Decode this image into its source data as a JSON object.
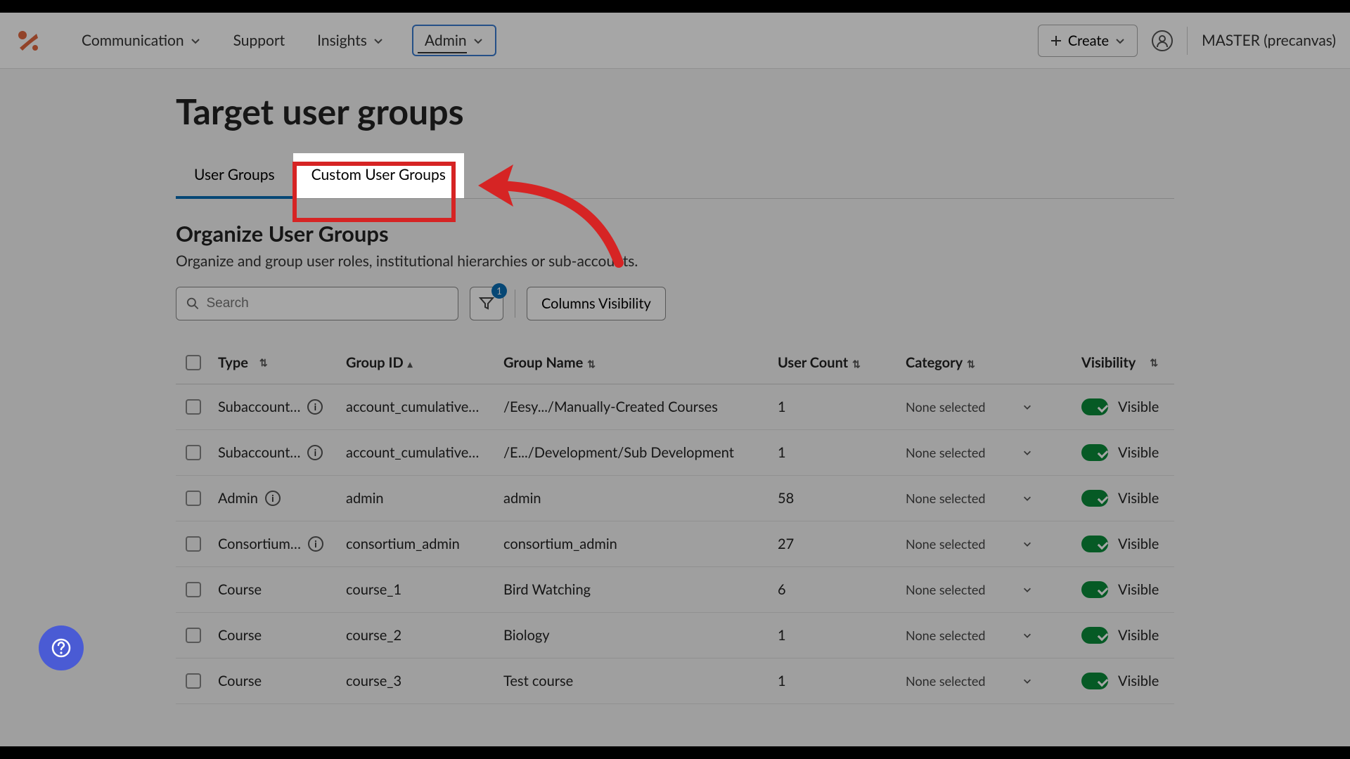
{
  "nav": {
    "items": [
      "Communication",
      "Support",
      "Insights",
      "Admin"
    ],
    "create": "Create",
    "username": "MASTER (precanvas)"
  },
  "page": {
    "title": "Target user groups"
  },
  "tabs": [
    {
      "label": "User Groups"
    },
    {
      "label": "Custom User Groups"
    }
  ],
  "section": {
    "title": "Organize User Groups",
    "desc": "Organize and group user roles, institutional hierarchies or sub-accounts."
  },
  "search": {
    "placeholder": "Search"
  },
  "filter": {
    "badge": "1"
  },
  "columns_btn": "Columns Visibility",
  "table": {
    "headers": {
      "type": "Type",
      "group_id": "Group ID",
      "group_name": "Group Name",
      "user_count": "User Count",
      "category": "Category",
      "visibility": "Visibility"
    },
    "category_placeholder": "None selected",
    "visibility_label": "Visible",
    "rows": [
      {
        "type": "Subaccount…",
        "info": true,
        "gid": "account_cumulative…",
        "gname": "/Eesy.../Manually-Created Courses",
        "count": "1"
      },
      {
        "type": "Subaccount…",
        "info": true,
        "gid": "account_cumulative…",
        "gname": "/E.../Development/Sub Development",
        "count": "1"
      },
      {
        "type": "Admin",
        "info": true,
        "gid": "admin",
        "gname": "admin",
        "count": "58"
      },
      {
        "type": "Consortium…",
        "info": true,
        "gid": "consortium_admin",
        "gname": "consortium_admin",
        "count": "27"
      },
      {
        "type": "Course",
        "info": false,
        "gid": "course_1",
        "gname": "Bird Watching",
        "count": "6"
      },
      {
        "type": "Course",
        "info": false,
        "gid": "course_2",
        "gname": "Biology",
        "count": "1"
      },
      {
        "type": "Course",
        "info": false,
        "gid": "course_3",
        "gname": "Test course",
        "count": "1"
      }
    ]
  }
}
